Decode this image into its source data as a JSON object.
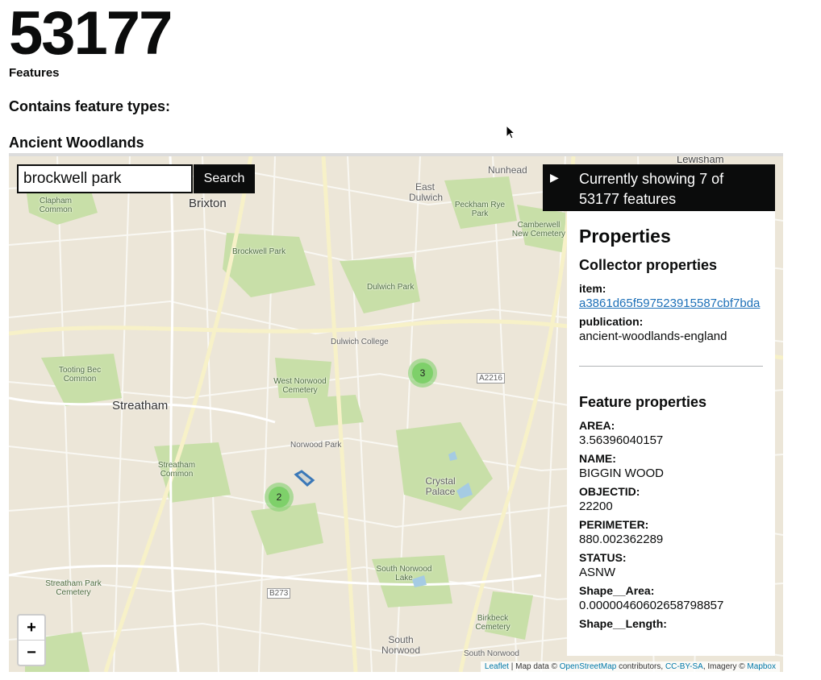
{
  "header": {
    "count": "53177",
    "count_label": "Features",
    "types_heading": "Contains feature types:",
    "type_name": "Ancient Woodlands"
  },
  "search": {
    "value": "brockwell park",
    "button_label": "Search"
  },
  "map": {
    "places": {
      "lewisham": "Lewisham",
      "nunhead": "Nunhead",
      "brixton": "Brixton",
      "clapham_common": "Clapham Common",
      "east_dulwich": "East Dulwich",
      "peckham_rye_park": "Peckham Rye Park",
      "camberwell_cemetery": "Camberwell New Cemetery",
      "brockwell_park": "Brockwell Park",
      "dulwich_park": "Dulwich Park",
      "dulwich_college": "Dulwich College",
      "tooting_bec": "Tooting Bec Common",
      "west_norwood": "West Norwood Cemetery",
      "streatham": "Streatham",
      "norwood_park": "Norwood Park",
      "streatham_common": "Streatham Common",
      "crystal_palace": "Crystal Palace",
      "streatham_park_cemetery": "Streatham Park Cemetery",
      "south_norwood_lake": "South Norwood Lake",
      "beckenham_cemetery": "Birkbeck Cemetery",
      "south_norwood": "South Norwood",
      "south_norwood2": "South Norwood",
      "road_a2216": "A2216",
      "road_b273": "B273"
    },
    "clusters": [
      {
        "count": "3"
      },
      {
        "count": "2"
      }
    ],
    "zoom_in": "+",
    "zoom_out": "−",
    "attribution": {
      "leaflet": "Leaflet",
      "map_data": " | Map data © ",
      "osm": "OpenStreetMap",
      "contributors": " contributors, ",
      "ccbysa": "CC-BY-SA",
      "imagery": ", Imagery © ",
      "mapbox": "Mapbox"
    }
  },
  "info": {
    "toggle_icon": "play-triangle-icon",
    "title": "Currently showing 7 of 53177 features",
    "properties_heading": "Properties",
    "collector_heading": "Collector properties",
    "collector": [
      {
        "key": "item:",
        "value": "a3861d65f597523915587cbf7bda",
        "link": true
      },
      {
        "key": "publication:",
        "value": "ancient-woodlands-england",
        "link": false
      }
    ],
    "feature_heading": "Feature properties",
    "feature": [
      {
        "key": "AREA:",
        "value": "3.56396040157"
      },
      {
        "key": "NAME:",
        "value": "BIGGIN WOOD"
      },
      {
        "key": "OBJECTID:",
        "value": "22200"
      },
      {
        "key": "PERIMETER:",
        "value": "880.002362289"
      },
      {
        "key": "STATUS:",
        "value": "ASNW"
      },
      {
        "key": "Shape__Area:",
        "value": "0.00000460602658798857"
      },
      {
        "key": "Shape__Length:",
        "value": ""
      }
    ]
  },
  "colors": {
    "text": "#0b0c0c",
    "link": "#1d70b8",
    "map_land": "#ece6d8",
    "park_green": "#c8dfa8",
    "cluster_green": "#7ed06a",
    "feature_outline": "#3a78b8"
  }
}
